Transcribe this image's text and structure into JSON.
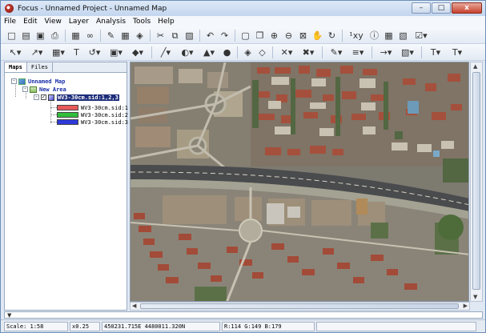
{
  "window": {
    "title": "Focus - Unnamed Project - Unnamed Map",
    "minimize": "–",
    "maximize": "□",
    "close": "x"
  },
  "menu": [
    "File",
    "Edit",
    "View",
    "Layer",
    "Analysis",
    "Tools",
    "Help"
  ],
  "toolbar1": [
    {
      "icon": "new-file-icon",
      "glyph": "□"
    },
    {
      "icon": "open-folder-icon",
      "glyph": "▤"
    },
    {
      "icon": "save-icon",
      "glyph": "▣"
    },
    {
      "icon": "print-icon",
      "glyph": "⎙"
    },
    {
      "sep": true
    },
    {
      "icon": "view-icon",
      "glyph": "▦"
    },
    {
      "icon": "link-icon",
      "glyph": "∞"
    },
    {
      "sep": true
    },
    {
      "icon": "edit-pencil-icon",
      "glyph": "✎"
    },
    {
      "icon": "table-icon",
      "glyph": "▦"
    },
    {
      "icon": "layers-icon",
      "glyph": "◈"
    },
    {
      "sep": true
    },
    {
      "icon": "cut-icon",
      "glyph": "✂"
    },
    {
      "icon": "copy-icon",
      "glyph": "⧉"
    },
    {
      "icon": "paste-icon",
      "glyph": "▨"
    },
    {
      "sep": true
    },
    {
      "icon": "undo-icon",
      "glyph": "↶"
    },
    {
      "icon": "redo-icon",
      "glyph": "↷"
    },
    {
      "sep": true
    },
    {
      "icon": "zoom-extent-icon",
      "glyph": "▢"
    },
    {
      "icon": "zoom-window-icon",
      "glyph": "❐"
    },
    {
      "icon": "zoom-in-icon",
      "glyph": "⊕"
    },
    {
      "icon": "zoom-out-icon",
      "glyph": "⊖"
    },
    {
      "icon": "zoom-box-icon",
      "glyph": "⊠"
    },
    {
      "icon": "pan-hand-icon",
      "glyph": "✋"
    },
    {
      "icon": "refresh-icon",
      "glyph": "↻"
    },
    {
      "sep": true
    },
    {
      "icon": "coordinates-icon",
      "glyph": "¹xy"
    },
    {
      "icon": "info-icon",
      "glyph": "ⓘ"
    },
    {
      "icon": "grid-icon",
      "glyph": "▦"
    },
    {
      "icon": "measure-icon",
      "glyph": "▧"
    },
    {
      "icon": "chart-dropdown-icon",
      "glyph": "☑▾"
    }
  ],
  "toolbar2": [
    {
      "icon": "select-arrow-icon",
      "glyph": "↖▾"
    },
    {
      "icon": "node-edit-icon",
      "glyph": "↗▾"
    },
    {
      "icon": "grid-snap-icon",
      "glyph": "▦▾"
    },
    {
      "icon": "text-tool-icon",
      "glyph": "T"
    },
    {
      "icon": "rotate-icon",
      "glyph": "↺▾"
    },
    {
      "icon": "select-box-icon",
      "glyph": "▣▾"
    },
    {
      "icon": "fill-icon",
      "glyph": "◆▾"
    },
    {
      "sep": true
    },
    {
      "icon": "line-tool-icon",
      "glyph": "╱▾"
    },
    {
      "icon": "shape-tool-icon",
      "glyph": "◐▾"
    },
    {
      "icon": "symbol-tool-icon",
      "glyph": "▲▾"
    },
    {
      "icon": "palette-icon",
      "glyph": "●"
    },
    {
      "sep": true
    },
    {
      "icon": "layer-up-icon",
      "glyph": "◈"
    },
    {
      "icon": "layer-down-icon",
      "glyph": "◇"
    },
    {
      "sep": true
    },
    {
      "icon": "cross-icon",
      "glyph": "✕▾"
    },
    {
      "icon": "multi-cross-icon",
      "glyph": "✖▾"
    },
    {
      "sep": true
    },
    {
      "icon": "pen-color-icon",
      "glyph": "✎▾"
    },
    {
      "icon": "line-style-icon",
      "glyph": "≡▾"
    },
    {
      "sep": true
    },
    {
      "icon": "arrow-style-icon",
      "glyph": "→▾"
    },
    {
      "icon": "fill-style-icon",
      "glyph": "▧▾"
    },
    {
      "sep": true
    },
    {
      "icon": "font-icon",
      "glyph": "T▾"
    },
    {
      "icon": "font-size-icon",
      "glyph": "T▾"
    }
  ],
  "tabs": [
    "Maps",
    "Files"
  ],
  "tree": {
    "map": "Unnamed Map",
    "area": "New Area",
    "layer": "WV3-30cm.sid:1,2,3",
    "bands": [
      {
        "label": "WV3-30cm.sid:1",
        "color": "#e85a5a"
      },
      {
        "label": "WV3-30cm.sid:2",
        "color": "#2fbf3a"
      },
      {
        "label": "WV3-30cm.sid:3",
        "color": "#2d3ad8"
      }
    ]
  },
  "status": {
    "scale": "Scale: 1:58",
    "zoom": "x0.25",
    "coord": "450231.715E 4480011.320N",
    "rgb": "R:114 G:149 B:179"
  }
}
